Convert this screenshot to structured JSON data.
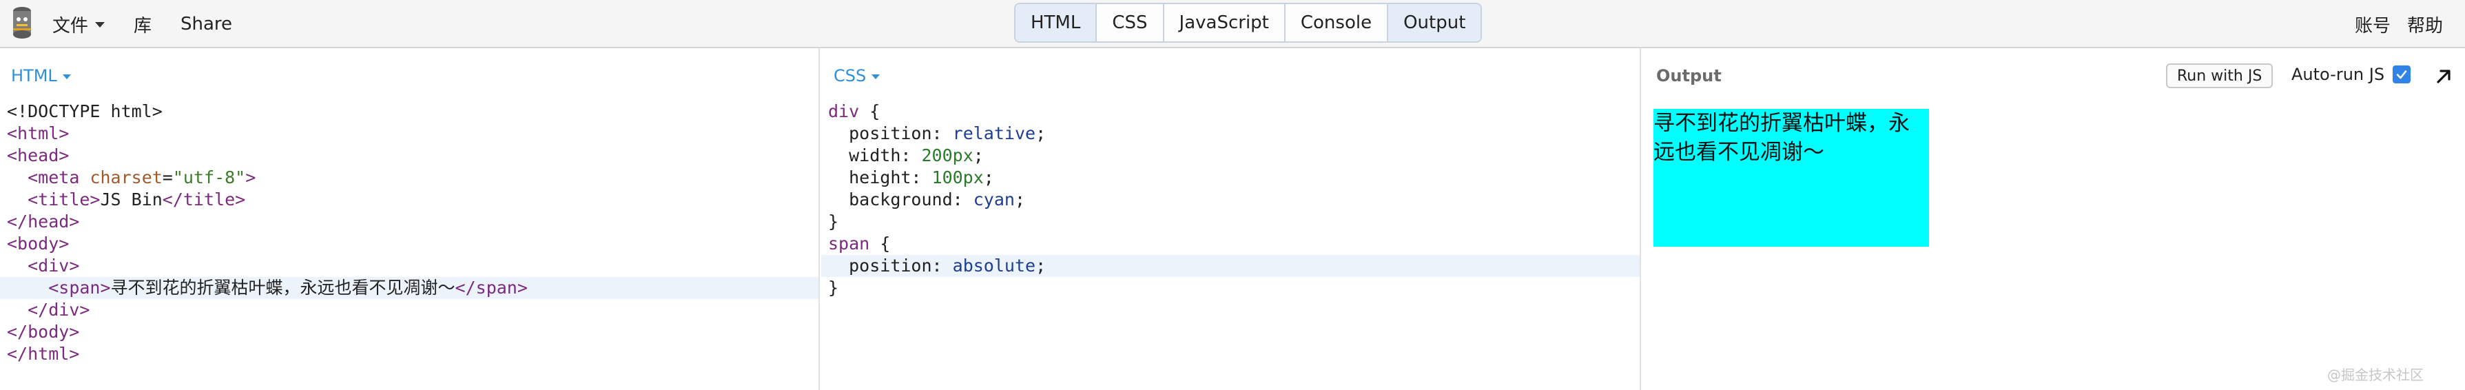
{
  "menu": {
    "file": "文件",
    "library": "库",
    "share": "Share",
    "account": "账号",
    "help": "帮助"
  },
  "tabs": [
    "HTML",
    "CSS",
    "JavaScript",
    "Console",
    "Output"
  ],
  "panes": {
    "html_label": "HTML",
    "css_label": "CSS",
    "output_label": "Output"
  },
  "output_controls": {
    "run_label": "Run with JS",
    "autorun_label": "Auto-run JS",
    "autorun_checked": true
  },
  "html_code": {
    "doctype": "<!DOCTYPE html>",
    "html_open": "<html>",
    "head_open": "<head>",
    "meta_tag": "<meta",
    "meta_attr": "charset",
    "meta_eq": "=",
    "meta_val": "\"utf-8\"",
    "meta_close": ">",
    "title_open": "<title>",
    "title_text": "JS Bin",
    "title_close": "</title>",
    "head_close": "</head>",
    "body_open": "<body>",
    "div_open": "<div>",
    "span_open": "<span>",
    "span_text": "寻不到花的折翼枯叶蝶，永远也看不见凋谢～",
    "span_close": "</span>",
    "div_close": "</div>",
    "body_close": "</body>",
    "html_close": "</html>"
  },
  "css_code": {
    "sel_div": "div",
    "sel_span": "span",
    "open_brace": " {",
    "close_brace": "}",
    "p_position": "position",
    "p_width": "width",
    "p_height": "height",
    "p_background": "background",
    "v_relative": "relative",
    "v_200": "200px",
    "v_100": "100px",
    "v_cyan": "cyan",
    "v_absolute": "absolute"
  },
  "output_text": "寻不到花的折翼枯叶蝶，永远也看不见凋谢～",
  "watermark": "@掘金技术社区",
  "colors": {
    "accent": "#2f8fd8",
    "checkbox": "#2f84e6",
    "output_box": "#00ffff"
  }
}
